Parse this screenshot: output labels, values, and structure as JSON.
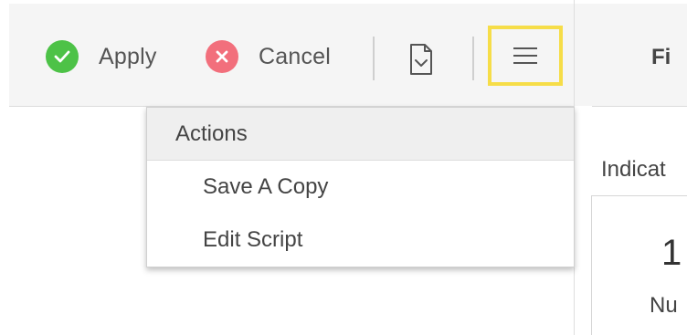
{
  "toolbar": {
    "apply_label": "Apply",
    "cancel_label": "Cancel",
    "apply_color": "#4dc247",
    "cancel_color": "#f26f7c",
    "highlight_color": "#f6dd48"
  },
  "right_panel": {
    "title": "Fi",
    "indicator_label": "Indicat",
    "card_value": "1",
    "card_label": "Nu"
  },
  "actions_menu": {
    "header": "Actions",
    "items": [
      {
        "label": "Save A Copy"
      },
      {
        "label": "Edit Script"
      }
    ]
  }
}
